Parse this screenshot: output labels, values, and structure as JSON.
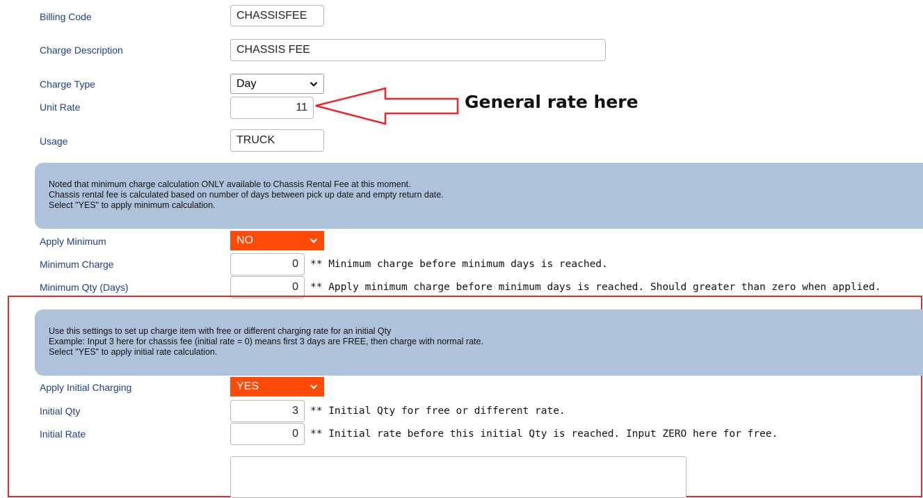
{
  "fields": {
    "billing_code": {
      "label": "Billing Code",
      "value": "CHASSISFEE"
    },
    "charge_description": {
      "label": "Charge Description",
      "value": "CHASSIS FEE"
    },
    "charge_type": {
      "label": "Charge Type",
      "value": "Day"
    },
    "unit_rate": {
      "label": "Unit Rate",
      "value": "11"
    },
    "usage": {
      "label": "Usage",
      "value": "TRUCK"
    }
  },
  "annotation": {
    "text": "General rate here",
    "color": "#e8262c"
  },
  "minimum_banner": {
    "lines": [
      "Noted that minimum charge calculation ONLY available to Chassis Rental Fee at this moment.",
      "Chassis rental fee is calculated based on number of days between pick up date and empty return date.",
      "Select \"YES\" to apply minimum calculation."
    ]
  },
  "minimum": {
    "apply": {
      "label": "Apply Minimum",
      "value": "NO"
    },
    "charge": {
      "label": "Minimum Charge",
      "value": "0",
      "note": "** Minimum charge before minimum days is reached."
    },
    "qty": {
      "label": "Minimum Qty (Days)",
      "value": "0",
      "note": "** Apply minimum charge before minimum days is reached. Should greater than zero when applied."
    }
  },
  "initial_banner": {
    "lines": [
      "Use this settings to set up charge item with free or different charging rate for an initial Qty",
      "Example: Input 3 here for chassis fee (initial rate = 0) means first 3 days are FREE, then charge with normal rate.",
      "Select \"YES\" to apply initial rate calculation."
    ]
  },
  "initial": {
    "apply": {
      "label": "Apply Initial Charging",
      "value": "YES"
    },
    "qty": {
      "label": "Initial Qty",
      "value": "3",
      "note": "** Initial Qty for free or different rate."
    },
    "rate": {
      "label": "Initial Rate",
      "value": "0",
      "note": "** Initial rate before this initial Qty is reached. Input ZERO here for free."
    }
  },
  "colors": {
    "label": "#1f3f8a",
    "banner": "#afc2dc",
    "select_active": "#ff4a0a",
    "highlight_box": "#e8262c"
  },
  "icons": [
    "chevron-down-icon",
    "left-arrow-annotation-icon"
  ]
}
